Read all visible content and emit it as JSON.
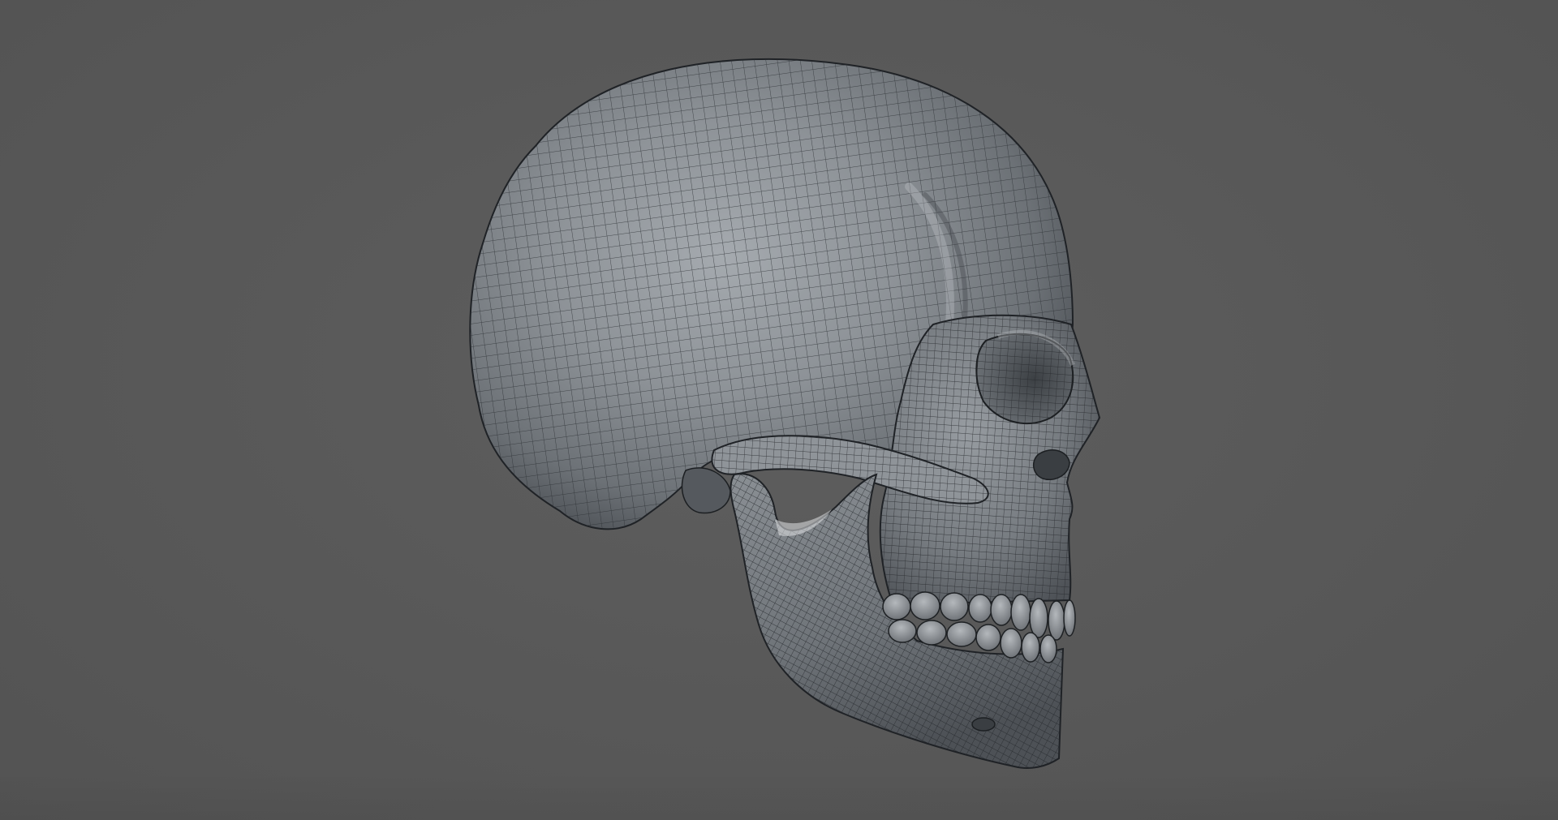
{
  "viewport": {
    "background_color": "#575757",
    "model_fill_color": "#8e9398",
    "wireframe_color": "#2a2d31",
    "model": {
      "name": "skull",
      "view": "right side",
      "shading": "wireframe-on-shaded"
    }
  }
}
